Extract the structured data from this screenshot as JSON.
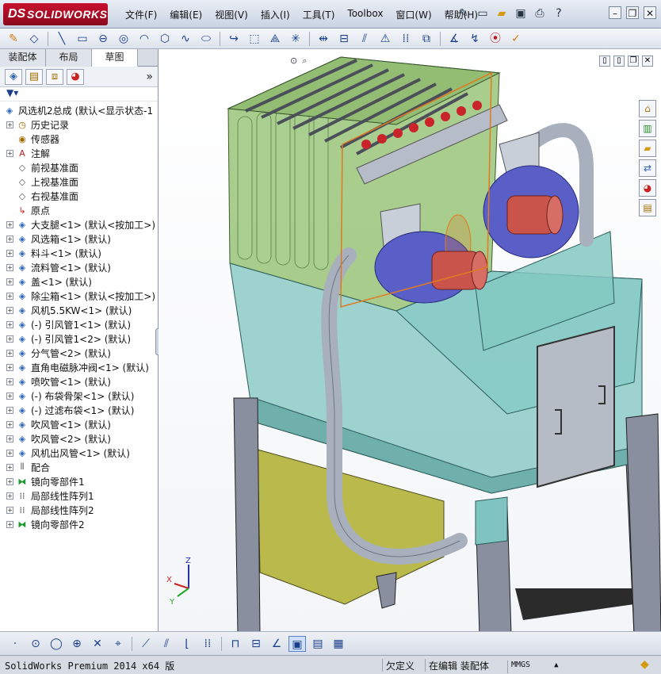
{
  "app": {
    "brand_prefix": "DS",
    "brand_name": "SOLIDWORKS"
  },
  "menus": [
    "文件(F)",
    "编辑(E)",
    "视图(V)",
    "插入(I)",
    "工具(T)",
    "Toolbox",
    "窗口(W)",
    "帮助(H)"
  ],
  "title_icons": [
    "pin-icon",
    "new-document-icon",
    "open-icon",
    "save-icon",
    "print-icon",
    "help-icon"
  ],
  "window_controls": [
    "minimize",
    "restore",
    "close"
  ],
  "toolbar_icons": [
    "sketch-icon",
    "smart-dimension-icon",
    "line-icon",
    "rectangle-icon",
    "slot-icon",
    "circle-icon",
    "arc-icon",
    "polygon-icon",
    "spline-icon",
    "ellipse-icon",
    "fillet-icon",
    "offset-icon",
    "mirror-icon",
    "linear-pattern-icon",
    "move-icon",
    "trim-icon",
    "convert-icon",
    "grid-icon",
    "relations-icon",
    "display-icon",
    "rebuild-icon",
    "options-icon"
  ],
  "left_panel": {
    "tabs": [
      {
        "label": "装配体",
        "active": false
      },
      {
        "label": "布局",
        "active": false
      },
      {
        "label": "草图",
        "active": true
      }
    ],
    "panel_icons": [
      "feature-manager-icon",
      "property-manager-icon",
      "configuration-manager-icon",
      "display-manager-icon"
    ],
    "tree": [
      {
        "label": "风选机2总成   (默认<显示状态-1",
        "icon": "assembly-icon",
        "root": true
      },
      {
        "label": "历史记录",
        "icon": "history-icon",
        "expander": "+"
      },
      {
        "label": "传感器",
        "icon": "sensor-icon",
        "expander": ""
      },
      {
        "label": "注解",
        "icon": "annotation-icon",
        "expander": "+"
      },
      {
        "label": "前视基准面",
        "icon": "plane-icon",
        "expander": ""
      },
      {
        "label": "上视基准面",
        "icon": "plane-icon",
        "expander": ""
      },
      {
        "label": "右视基准面",
        "icon": "plane-icon",
        "expander": ""
      },
      {
        "label": "原点",
        "icon": "origin-icon",
        "expander": ""
      },
      {
        "label": "大支腿<1> (默认<按加工>)",
        "icon": "part-icon",
        "expander": "+"
      },
      {
        "label": "风选箱<1> (默认)",
        "icon": "part-icon",
        "expander": "+"
      },
      {
        "label": "料斗<1> (默认)",
        "icon": "part-icon",
        "expander": "+"
      },
      {
        "label": "流料管<1> (默认)",
        "icon": "part-icon",
        "expander": "+"
      },
      {
        "label": "盖<1> (默认)",
        "icon": "part-icon",
        "expander": "+"
      },
      {
        "label": "除尘箱<1> (默认<按加工>)",
        "icon": "part-icon",
        "expander": "+"
      },
      {
        "label": "风机5.5KW<1> (默认)",
        "icon": "part-icon",
        "expander": "+"
      },
      {
        "label": "(-) 引风管1<1> (默认)",
        "icon": "part-icon",
        "expander": "+"
      },
      {
        "label": "(-) 引风管1<2> (默认)",
        "icon": "part-icon",
        "expander": "+"
      },
      {
        "label": "分气管<2> (默认)",
        "icon": "part-icon",
        "expander": "+"
      },
      {
        "label": "直角电磁脉冲阀<1> (默认)",
        "icon": "part-icon",
        "expander": "+"
      },
      {
        "label": "喷吹管<1> (默认)",
        "icon": "part-icon",
        "expander": "+"
      },
      {
        "label": "(-) 布袋骨架<1> (默认)",
        "icon": "part-icon",
        "expander": "+"
      },
      {
        "label": "(-) 过滤布袋<1> (默认)",
        "icon": "part-icon",
        "expander": "+"
      },
      {
        "label": "吹风管<1> (默认)",
        "icon": "part-icon",
        "expander": "+"
      },
      {
        "label": "吹风管<2> (默认)",
        "icon": "part-icon",
        "expander": "+"
      },
      {
        "label": "风机出风管<1> (默认)",
        "icon": "part-icon",
        "expander": "+"
      },
      {
        "label": "配合",
        "icon": "mate-icon",
        "expander": "+"
      },
      {
        "label": "镜向零部件1",
        "icon": "mirror-component-icon",
        "expander": "+"
      },
      {
        "label": "局部线性阵列1",
        "icon": "pattern-icon",
        "expander": "+"
      },
      {
        "label": "局部线性阵列2",
        "icon": "pattern-icon",
        "expander": "+"
      },
      {
        "label": "镜向零部件2",
        "icon": "mirror-component-icon",
        "expander": "+"
      }
    ]
  },
  "viewport": {
    "heads_up_icons": [
      "zoom-fit-icon",
      "zoom-area-icon",
      "section-view-icon",
      "view-orientation-icon",
      "display-style-icon",
      "appearance-icon",
      "scene-icon"
    ],
    "task_pane_icons": [
      "home-icon",
      "design-library-icon",
      "file-explorer-icon",
      "view-palette-icon",
      "appearances-icon",
      "custom-properties-icon"
    ],
    "triad": {
      "x": "X",
      "y": "Y",
      "z": "Z"
    }
  },
  "sketch_toolbar_icons": [
    "point-icon",
    "circle-icon",
    "polygon-icon",
    "trim-icon",
    "dimension-icon",
    "fillet-icon",
    "mirror-icon",
    "linear-icon",
    "construction-icon",
    "grid-icon",
    "relation-icon",
    "view-icon",
    "shaded-icon",
    "wireframe-icon",
    "table-icon"
  ],
  "status": {
    "app_version": "SolidWorks Premium 2014 x64 版",
    "definition": "欠定义",
    "editing": "在编辑 装配体",
    "units": "MMGS",
    "units_arrow": "▲"
  },
  "colors": {
    "hopper_green": "#8fbf6b",
    "casing_teal": "#7fc4c0",
    "duct_grey": "#a9b0bd",
    "fan_blue": "#5a5fc8",
    "motor_red": "#c9544c",
    "bin_olive": "#b9b94c",
    "leg_grey": "#8a8fa0",
    "selection_orange": "#e07a20",
    "brand_red": "#c8102e"
  }
}
